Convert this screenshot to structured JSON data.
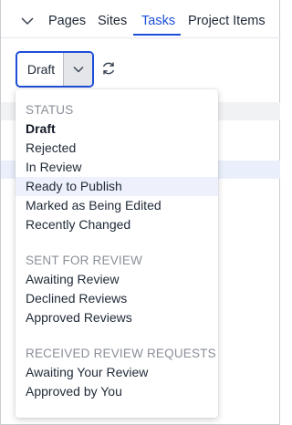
{
  "tabs": {
    "items": [
      {
        "label": "Pages"
      },
      {
        "label": "Sites"
      },
      {
        "label": "Tasks"
      },
      {
        "label": "Project Items"
      }
    ],
    "active": "Tasks"
  },
  "filter": {
    "selected_value": "Draft"
  },
  "menu": {
    "groups": [
      {
        "header": "STATUS",
        "items": [
          {
            "label": "Draft",
            "state": "selected"
          },
          {
            "label": "Rejected"
          },
          {
            "label": "In Review"
          },
          {
            "label": "Ready to Publish",
            "state": "hovered"
          },
          {
            "label": "Marked as Being Edited"
          },
          {
            "label": "Recently Changed"
          }
        ]
      },
      {
        "header": "SENT FOR REVIEW",
        "items": [
          {
            "label": "Awaiting Review"
          },
          {
            "label": "Declined Reviews"
          },
          {
            "label": "Approved Reviews"
          }
        ]
      },
      {
        "header": "RECEIVED REVIEW REQUESTS",
        "items": [
          {
            "label": "Awaiting Your Review"
          },
          {
            "label": "Approved by You"
          }
        ]
      }
    ]
  },
  "colors": {
    "accent": "#1d4ed8",
    "hover_bg": "#eef1fb",
    "group_header": "#8a8f98"
  },
  "icons": {
    "tabs_toggle": "chevron-down-icon",
    "dropdown_toggle": "chevron-down-icon",
    "refresh": "refresh-icon"
  }
}
